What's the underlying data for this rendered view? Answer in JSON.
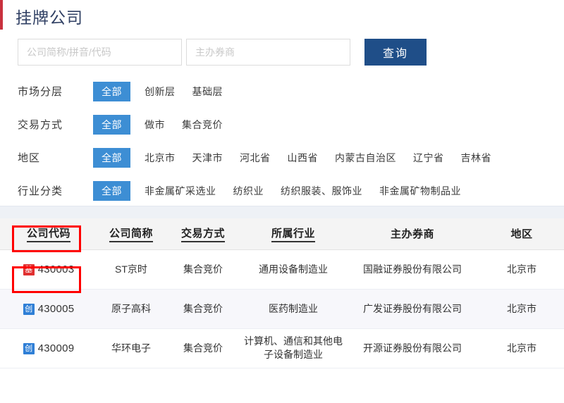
{
  "header": {
    "title": "挂牌公司",
    "accent_color": "#c9313e"
  },
  "search": {
    "company_placeholder": "公司简称/拼音/代码",
    "company_value": "",
    "broker_placeholder": "主办券商",
    "broker_value": "",
    "submit_label": "查询",
    "submit_color": "#1f4e88"
  },
  "filters": {
    "active_color": "#3d8ed4",
    "rows": [
      {
        "label": "市场分层",
        "options": [
          {
            "text": "全部",
            "active": true
          },
          {
            "text": "创新层",
            "active": false
          },
          {
            "text": "基础层",
            "active": false
          }
        ]
      },
      {
        "label": "交易方式",
        "options": [
          {
            "text": "全部",
            "active": true
          },
          {
            "text": "做市",
            "active": false
          },
          {
            "text": "集合竞价",
            "active": false
          }
        ]
      },
      {
        "label": "地区",
        "options": [
          {
            "text": "全部",
            "active": true
          },
          {
            "text": "北京市",
            "active": false
          },
          {
            "text": "天津市",
            "active": false
          },
          {
            "text": "河北省",
            "active": false
          },
          {
            "text": "山西省",
            "active": false
          },
          {
            "text": "内蒙古自治区",
            "active": false
          },
          {
            "text": "辽宁省",
            "active": false
          },
          {
            "text": "吉林省",
            "active": false
          }
        ]
      },
      {
        "label": "行业分类",
        "options": [
          {
            "text": "全部",
            "active": true
          },
          {
            "text": "非金属矿采选业",
            "active": false
          },
          {
            "text": "纺织业",
            "active": false
          },
          {
            "text": "纺织服装、服饰业",
            "active": false
          },
          {
            "text": "非金属矿物制品业",
            "active": false
          }
        ]
      }
    ]
  },
  "table": {
    "columns": [
      {
        "label": "公司代码",
        "sortable": true
      },
      {
        "label": "公司简称",
        "sortable": true
      },
      {
        "label": "交易方式",
        "sortable": true
      },
      {
        "label": "所属行业",
        "sortable": true
      },
      {
        "label": "主办券商",
        "sortable": false
      },
      {
        "label": "地区",
        "sortable": false
      }
    ],
    "rows": [
      {
        "tier_badge": "基",
        "tier_type": "base",
        "code": "430003",
        "abbr": "ST京时",
        "trade": "集合竞价",
        "industry": "通用设备制造业",
        "broker": "国融证券股份有限公司",
        "region": "北京市"
      },
      {
        "tier_badge": "创",
        "tier_type": "innov",
        "code": "430005",
        "abbr": "原子高科",
        "trade": "集合竞价",
        "industry": "医药制造业",
        "broker": "广发证券股份有限公司",
        "region": "北京市"
      },
      {
        "tier_badge": "创",
        "tier_type": "innov",
        "code": "430009",
        "abbr": "华环电子",
        "trade": "集合竞价",
        "industry": "计算机、通信和其他电子设备制造业",
        "broker": "开源证券股份有限公司",
        "region": "北京市"
      }
    ]
  },
  "annotations": {
    "box_color": "#ff0000",
    "count": 2
  }
}
